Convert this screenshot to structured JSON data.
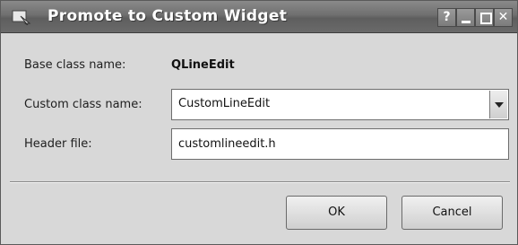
{
  "window": {
    "title": "Promote to Custom Widget",
    "buttons": {
      "help": "?",
      "close": "✕"
    }
  },
  "form": {
    "base_class_label": "Base class name:",
    "base_class_value": "QLineEdit",
    "custom_class_label": "Custom class name:",
    "custom_class_value": "CustomLineEdit",
    "header_file_label": "Header file:",
    "header_file_value": "customlineedit.h"
  },
  "actions": {
    "ok_label": "OK",
    "cancel_label": "Cancel"
  }
}
